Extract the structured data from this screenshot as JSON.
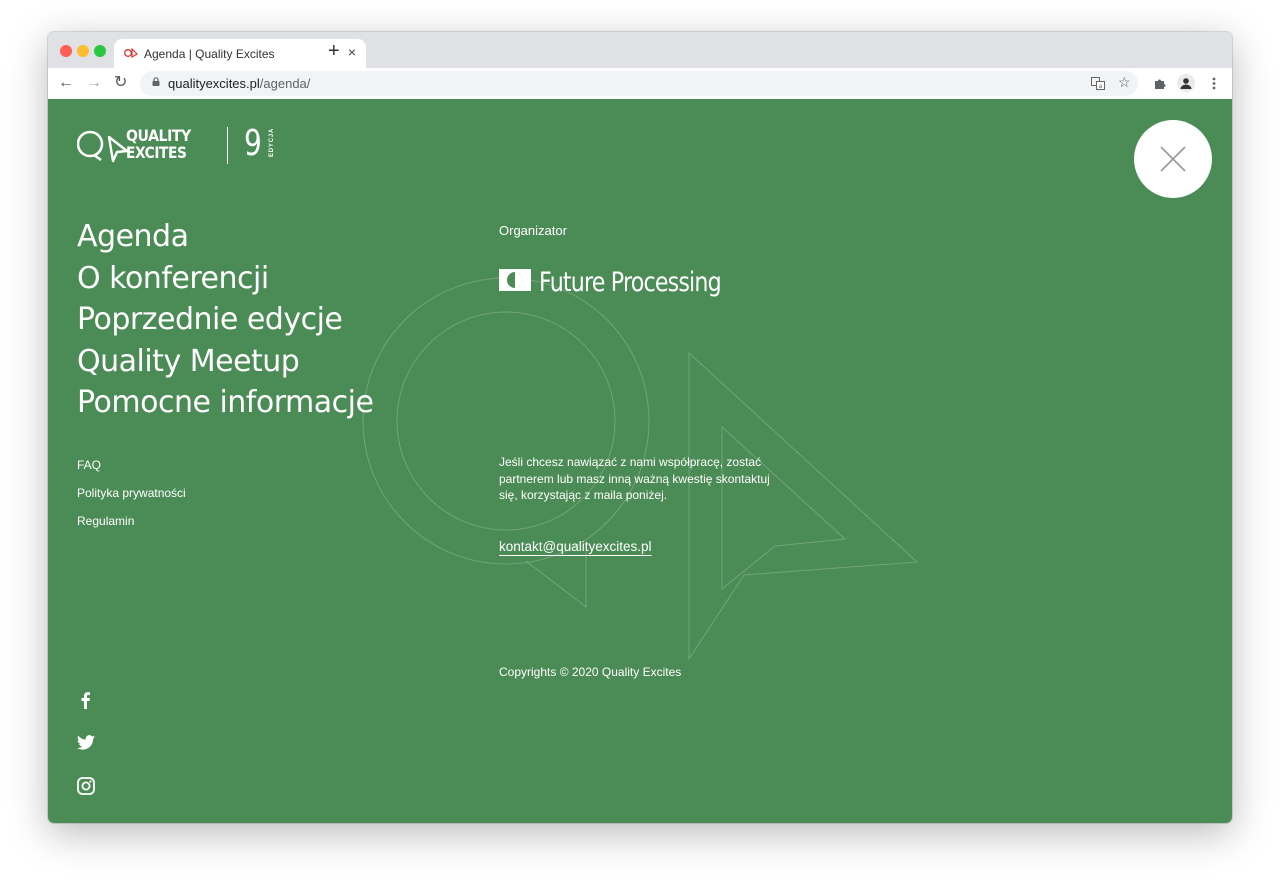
{
  "browser": {
    "tab_title": "Agenda | Quality Excites",
    "tab_close": "×",
    "new_tab": "+",
    "url_host": "qualityexcites.pl",
    "url_path": "/agenda/",
    "nav_back": "←",
    "nav_forward": "→",
    "nav_reload": "↻",
    "traffic_light_colors": [
      "#fe5f57",
      "#febc2e",
      "#28c840"
    ]
  },
  "site": {
    "logo_line1": "QUALITY",
    "logo_line2": "EXCITES",
    "edition_number": "9",
    "edition_label": "EDYCJA",
    "background_color": "#4b8b55",
    "main_menu": [
      "Agenda",
      "O konferencji",
      "Poprzednie edycje",
      "Quality Meetup",
      "Pomocne informacje"
    ],
    "sub_menu": [
      "FAQ",
      "Polityka prywatności",
      "Regulamin"
    ],
    "organizer_label": "Organizator",
    "organizer_name": "Future Processing",
    "contact_text": "Jeśli chcesz nawiązać z nami współpracę, zostać partnerem lub masz inną ważną kwestię skontaktuj się, korzystając z maila poniżej.",
    "contact_email": "kontakt@qualityexcites.pl",
    "copyright": "Copyrights © 2020 Quality Excites",
    "social_icons": [
      "facebook-icon",
      "twitter-icon",
      "instagram-icon"
    ]
  }
}
